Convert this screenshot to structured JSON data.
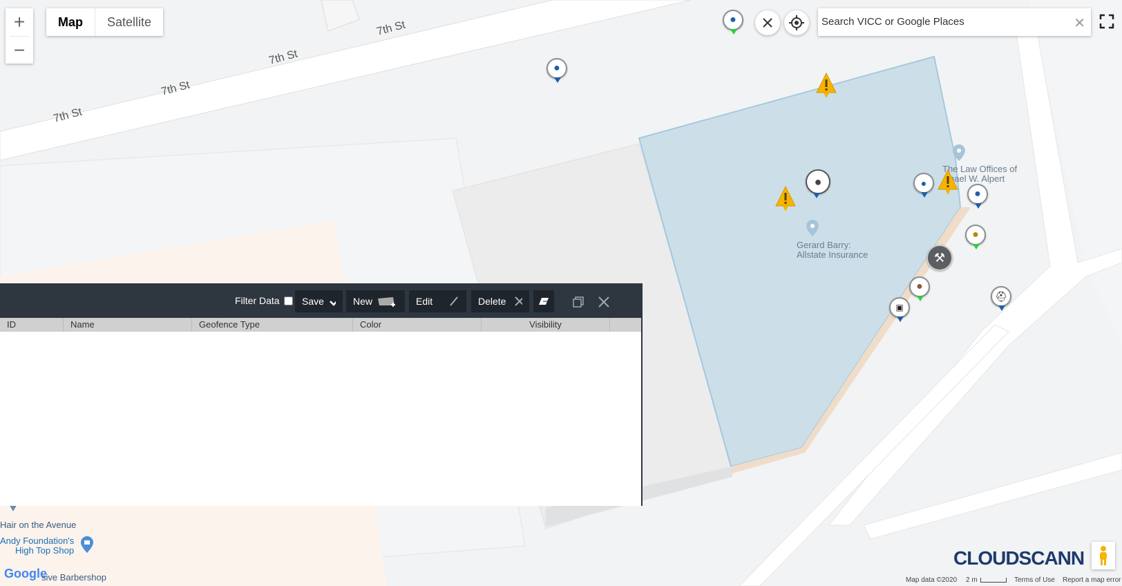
{
  "map_type": {
    "map_label": "Map",
    "satellite_label": "Satellite",
    "selected": "Map"
  },
  "zoom": {
    "in_symbol": "+",
    "out_symbol": "−"
  },
  "search": {
    "placeholder": "Search VICC or Google Places",
    "value": "",
    "clear_symbol": "✕"
  },
  "streets": [
    "7th St",
    "7th St",
    "7th St",
    "7th St"
  ],
  "places": {
    "law_offices_line1": "The Law Offices of",
    "law_offices_line2": "hael W. Alpert",
    "insurance_line1": "Gerard Barry:",
    "insurance_line2": "Allstate Insurance",
    "hair": "Hair on the Avenue",
    "andy_line1": "Andy Foundation's",
    "andy_line2": "High Top Shop",
    "barbershop": "sive Barbershop"
  },
  "geofence_panel": {
    "filter_label": "Filter Data",
    "filter_checked": false,
    "save_label": "Save",
    "new_label": "New",
    "edit_label": "Edit",
    "delete_label": "Delete",
    "columns": [
      "ID",
      "Name",
      "Geofence Type",
      "Color",
      "Visibility"
    ],
    "rows": []
  },
  "branding": {
    "logo_text": "CLOUDSCANN",
    "google_text": "Google"
  },
  "footer": {
    "map_data": "Map data ©2020",
    "scale": "2 m",
    "terms": "Terms of Use",
    "report": "Report a map error"
  },
  "colors": {
    "geofence_fill": "#c9dde8",
    "geofence_stroke": "#9cc5dc",
    "panel_dark": "#2e3640",
    "warning": "#f5b400",
    "pin_blue": "#1f5fa8",
    "pin_green": "#2ecc40"
  },
  "icons": [
    "plus-icon",
    "minus-icon",
    "close-icon",
    "locate-icon",
    "fullscreen-icon",
    "checkmark-icon",
    "ruler-icon",
    "pencil-icon",
    "x-icon",
    "eraser-icon",
    "restore-window-icon",
    "warning-icon",
    "pegman-icon",
    "place-pin-icon"
  ]
}
